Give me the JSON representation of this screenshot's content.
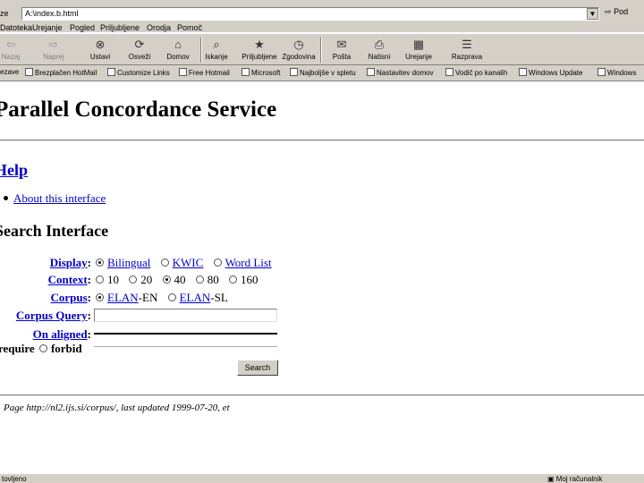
{
  "browser": {
    "address_label": "ze",
    "address_value": "A:\\index.b.html",
    "go_label": "Pod",
    "menu": [
      "Datoteka",
      "Urejanje",
      "Pogled",
      "Priljubljene",
      "Orodja",
      "Pomoč"
    ],
    "toolbar": [
      {
        "label": "Nazaj",
        "icon": "back-arrow-icon",
        "disabled": true
      },
      {
        "label": "Naprej",
        "icon": "forward-arrow-icon",
        "disabled": true
      },
      {
        "label": "Ustavi",
        "icon": "stop-icon",
        "disabled": false
      },
      {
        "label": "Osveži",
        "icon": "refresh-icon",
        "disabled": false
      },
      {
        "label": "Domov",
        "icon": "home-icon",
        "disabled": false
      },
      {
        "label": "Iskanje",
        "icon": "search-icon",
        "disabled": false
      },
      {
        "label": "Priljubljene",
        "icon": "favorites-icon",
        "disabled": false
      },
      {
        "label": "Zgodovina",
        "icon": "history-icon",
        "disabled": false
      },
      {
        "label": "Pošta",
        "icon": "mail-icon",
        "disabled": false
      },
      {
        "label": "Natisni",
        "icon": "print-icon",
        "disabled": false
      },
      {
        "label": "Urejanje",
        "icon": "edit-icon",
        "disabled": false
      },
      {
        "label": "Razprava",
        "icon": "discuss-icon",
        "disabled": false
      }
    ],
    "links": [
      "ezave",
      "Brezplačen HotMail",
      "Customize Links",
      "Free Hotmail",
      "Microsoft",
      "Najboljše v spletu",
      "Nastavitev domov",
      "Vodič po kanalih",
      "Windows Update",
      "Windows"
    ],
    "status_left": "tovljeno",
    "status_right": "Moj računalnik"
  },
  "page": {
    "title": "Parallel Concordance Service",
    "help_heading": "Help",
    "help_link": "About this interface",
    "search_heading": "Search Interface",
    "form": {
      "display_label": "Display",
      "display_options": [
        "Bilingual",
        "KWIC",
        "Word List"
      ],
      "display_selected": 0,
      "context_label": "Context",
      "context_options": [
        "10",
        "20",
        "40",
        "80",
        "160"
      ],
      "context_selected": 2,
      "corpus_label": "Corpus",
      "corpus_options": [
        {
          "link": "ELAN",
          "suffix": "-EN"
        },
        {
          "link": "ELAN",
          "suffix": "-SL"
        }
      ],
      "corpus_selected": 0,
      "query_label": "Corpus Query",
      "query_value": "",
      "aligned_label": "On aligned",
      "aligned_value": "",
      "require_label": "require",
      "forbid_label": "forbid",
      "search_button": "Search"
    },
    "footer": "Page http://nl2.ijs.si/corpus/, last updated 1999-07-20, et"
  }
}
